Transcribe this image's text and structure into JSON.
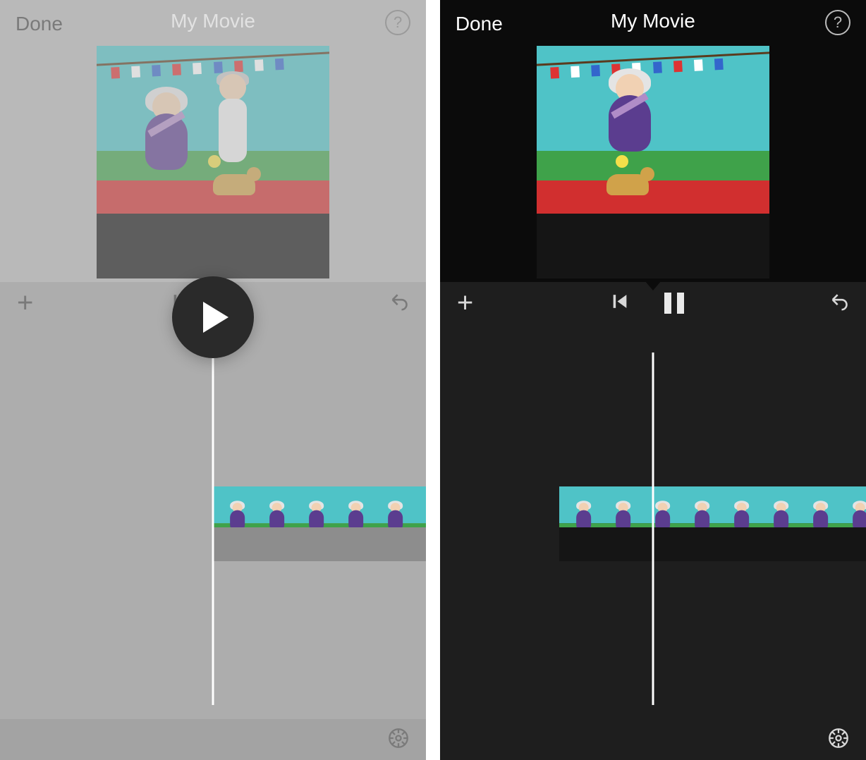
{
  "left": {
    "done_label": "Done",
    "title": "My Movie",
    "help_label": "?",
    "add_label": "+",
    "state": "paused_overlay"
  },
  "right": {
    "done_label": "Done",
    "title": "My Movie",
    "help_label": "?",
    "add_label": "+",
    "state": "playing"
  },
  "icons": {
    "skip_back": "skip-back-icon",
    "undo": "undo-icon",
    "gear": "gear-icon",
    "play": "play-icon",
    "pause": "pause-icon",
    "help": "help-icon",
    "add": "add-icon"
  }
}
